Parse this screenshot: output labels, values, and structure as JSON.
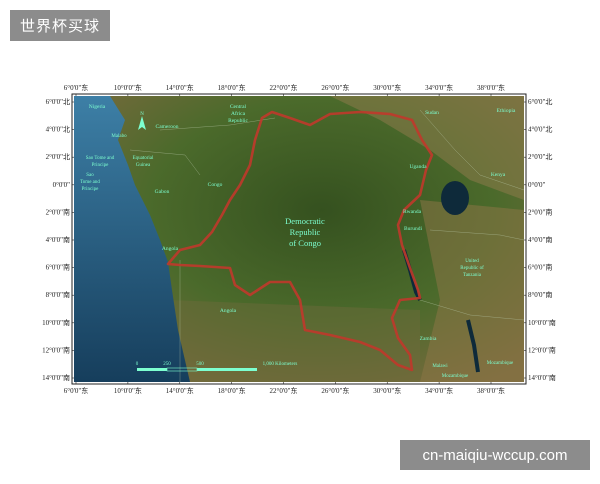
{
  "header": {
    "title": "世界杯买球"
  },
  "footer": {
    "site": "cn-maiqiu-wccup.com"
  },
  "map": {
    "ticks_top": [
      "6°0'0\"东",
      "10°0'0\"东",
      "14°0'0\"东",
      "18°0'0\"东",
      "22°0'0\"东",
      "26°0'0\"东",
      "30°0'0\"东",
      "34°0'0\"东",
      "38°0'0\"东"
    ],
    "ticks_bottom": [
      "6°0'0\"东",
      "10°0'0\"东",
      "14°0'0\"东",
      "18°0'0\"东",
      "22°0'0\"东",
      "26°0'0\"东",
      "30°0'0\"东",
      "34°0'0\"东",
      "38°0'0\"东"
    ],
    "ticks_left": [
      "6°0'0\"北",
      "4°0'0\"北",
      "2°0'0\"北",
      "0°0'0\"",
      "2°0'0\"南",
      "4°0'0\"南",
      "6°0'0\"南",
      "8°0'0\"南",
      "10°0'0\"南",
      "12°0'0\"南",
      "14°0'0\"南"
    ],
    "ticks_right": [
      "6°0'0\"北",
      "4°0'0\"北",
      "2°0'0\"北",
      "0°0'0\"",
      "2°0'0\"南",
      "4°0'0\"南",
      "6°0'0\"南",
      "8°0'0\"南",
      "10°0'0\"南",
      "12°0'0\"南",
      "14°0'0\"南"
    ],
    "labels": {
      "drc_1": "Democratic",
      "drc_2": "Republic",
      "drc_3": "of Congo",
      "nigeria": "Nigeria",
      "cameroon": "Cameroon",
      "car_1": "Central",
      "car_2": "Africa",
      "car_3": "Republic",
      "sudan": "Sudan",
      "ethiopia": "Ethiopia",
      "malabo": "Malabo",
      "stp_1": "Sao Tome and",
      "stp_2": "Principe",
      "stp_3": "Sao",
      "stp_4": "Tome and",
      "stp_5": "Principe",
      "eqg_1": "Equatorial",
      "eqg_2": "Guinea",
      "gabon": "Gabon",
      "congo": "Congo",
      "uganda": "Uganda",
      "kenya": "Kenya",
      "rwanda": "Rwanda",
      "burundi": "Burundi",
      "tanzania_1": "United",
      "tanzania_2": "Republic of",
      "tanzania_3": "Tanzania",
      "angola_n": "Angola",
      "angola_s": "Angola",
      "zambia": "Zambia",
      "malawi": "Malawi",
      "mozambique": "Mozambique",
      "mozambique_2": "Mozambique"
    },
    "scale": {
      "zero": "0",
      "mid1": "250",
      "mid2": "500",
      "end": "1,000 Kilometers"
    },
    "north_label": "N",
    "colors": {
      "border": "#c0392b",
      "label": "#7dffd0",
      "ocean": "#1f4f6e",
      "land": "#4a6a2c"
    }
  }
}
